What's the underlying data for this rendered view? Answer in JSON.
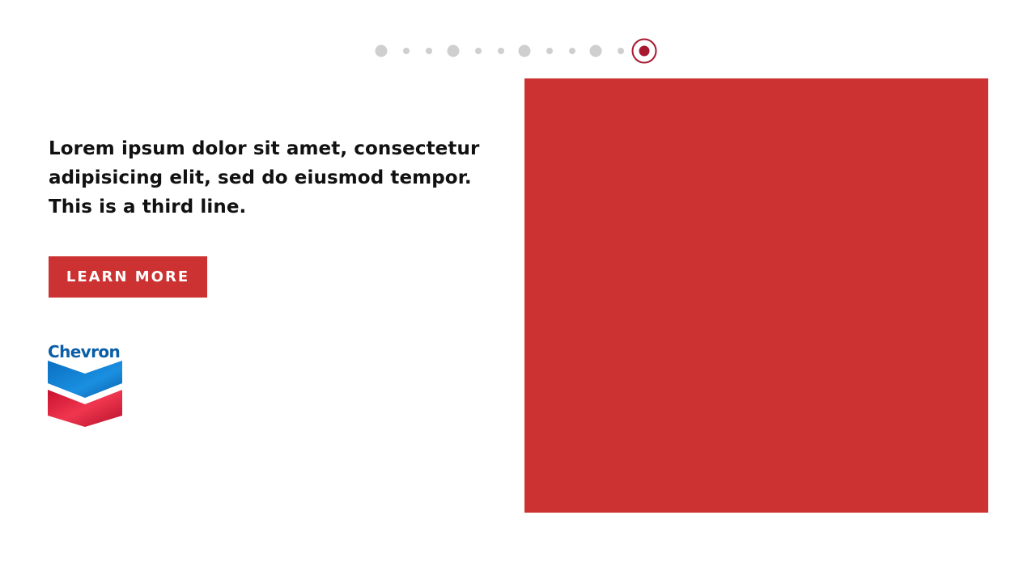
{
  "pager": {
    "dots": [
      {
        "size": "lg",
        "active": false
      },
      {
        "size": "sm",
        "active": false
      },
      {
        "size": "sm",
        "active": false
      },
      {
        "size": "lg",
        "active": false
      },
      {
        "size": "sm",
        "active": false
      },
      {
        "size": "sm",
        "active": false
      },
      {
        "size": "lg",
        "active": false
      },
      {
        "size": "sm",
        "active": false
      },
      {
        "size": "sm",
        "active": false
      },
      {
        "size": "lg",
        "active": false
      },
      {
        "size": "sm",
        "active": false
      },
      {
        "size": "lg",
        "active": true
      }
    ]
  },
  "hero": {
    "headline": "Lorem ipsum dolor sit amet, consectetur adipisicing elit, sed do eiusmod tempor. This is a third line.",
    "cta_label": "LEARN MORE"
  },
  "brand": {
    "logo_text": "Chevron"
  },
  "colors": {
    "accent": "#cd3232",
    "active_dot": "#a6192e",
    "inactive_dot": "#cfcfcf",
    "panel": "#cd3232",
    "logo_blue": "#0a5ea8"
  }
}
